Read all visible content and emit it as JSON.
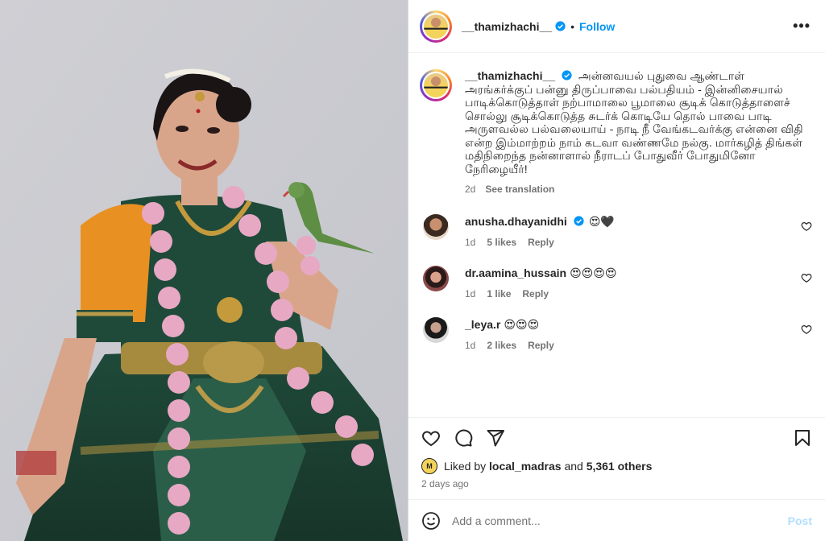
{
  "post": {
    "username": "__thamizhachi__",
    "follow_label": "Follow",
    "separator": "•",
    "more_label": "•••",
    "caption": "அன்னவயல் புதுவை ஆண்டாள் அரங்கர்க்குப் பன்னு திருப்பாவை பல்பதியம் - இன்னிசையால் பாடிக்கொடுத்தாள் நற்பாமாலை பூமாலை சூடிக் கொடுத்தாளைச் சொல்லு சூடிக்கொடுத்த சுடர்க் கொடியே தொல் பாவை பாடி அருளவல்ல பல்வலையாய் - நாடி நீ வேங்கடவர்க்கு என்னை விதி என்ற இம்மாற்றம் நாம் கடவா வண்ணமே நல்கு. மார்கழித் திங்கள் மதிநிறைந்த நன்னாளால் நீராடப் போதுவீர் போதுமினோ நேரிழையீர்!",
    "caption_age": "2d",
    "see_translation": "See translation"
  },
  "comments": [
    {
      "username": "anusha.dhayanidhi",
      "verified": true,
      "text": "😍🖤",
      "age": "1d",
      "likes": "5 likes",
      "reply": "Reply"
    },
    {
      "username": "dr.aamina_hussain",
      "verified": false,
      "text": "😍😍😍😍",
      "age": "1d",
      "likes": "1 like",
      "reply": "Reply"
    },
    {
      "username": "_leya.r",
      "verified": false,
      "text": "😍😍😍",
      "age": "1d",
      "likes": "2 likes",
      "reply": "Reply"
    }
  ],
  "likes": {
    "prefix": "Liked by",
    "liker": "local_madras",
    "joiner": "and",
    "count": "5,361 others",
    "avatar_label": "M"
  },
  "timestamp": "2 days ago",
  "add_comment": {
    "placeholder": "Add a comment...",
    "post_label": "Post"
  },
  "colors": {
    "accent": "#0095f6",
    "post_disabled": "#b2dffc",
    "muted": "#737373"
  }
}
